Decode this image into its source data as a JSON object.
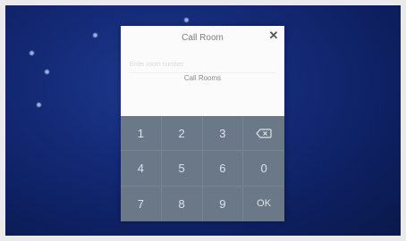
{
  "dialog": {
    "title": "Call Room",
    "close_glyph": "✕",
    "input_placeholder": "Enter room number",
    "room_label": "Call Rooms"
  },
  "keypad": {
    "keys": [
      "1",
      "2",
      "3",
      "backspace",
      "4",
      "5",
      "6",
      "0",
      "7",
      "8",
      "9",
      "OK"
    ],
    "backspace_icon": "backspace-icon"
  },
  "colors": {
    "background": "#142b78",
    "dialog_header": "#fbfbfb",
    "keypad": "#6a7887",
    "key_text": "#dce3ea"
  }
}
